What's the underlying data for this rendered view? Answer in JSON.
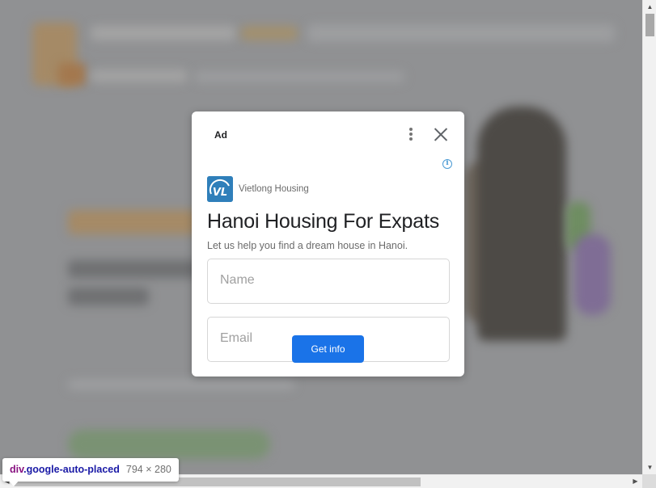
{
  "ad": {
    "label": "Ad",
    "advertiser": "Vietlong Housing",
    "logo_text": "VL",
    "headline": "Hanoi Housing For Expats",
    "description": "Let us help you find a dream house in Hanoi.",
    "fields": {
      "name_placeholder": "Name",
      "email_placeholder": "Email"
    },
    "cta_label": "Get info",
    "info_glyph": "i",
    "icons": [
      "more-vert-icon",
      "close-icon",
      "info-icon"
    ],
    "colors": {
      "cta": "#1a73e8",
      "logo": "#2f7fba",
      "info": "#4a9ad4"
    }
  },
  "devtools_tooltip": {
    "tag": "div",
    "class_name": ".google-auto-placed",
    "dimensions": "794 × 280"
  },
  "scrollbars": {
    "up_arrow": "▲",
    "down_arrow": "▼",
    "left_arrow": "◀",
    "right_arrow": "▶"
  }
}
